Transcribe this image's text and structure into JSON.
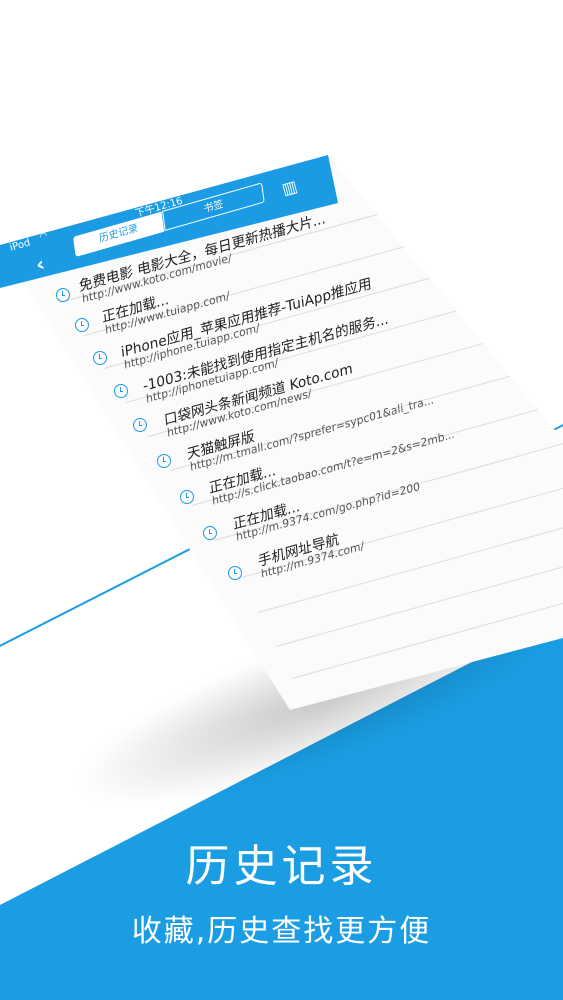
{
  "status_bar": {
    "carrier": "iPod",
    "time": "下午12:16"
  },
  "nav": {
    "tabs": [
      {
        "label": "历史记录",
        "active": true
      },
      {
        "label": "书签",
        "active": false
      }
    ],
    "back_icon": "chevron-left-icon",
    "trash_icon": "trash-icon"
  },
  "history": [
    {
      "title": "免费电影 电影大全，每日更新热播大片...",
      "url": "http://www.koto.com/movie/"
    },
    {
      "title": "正在加载...",
      "url": "http://www.tuiapp.com/"
    },
    {
      "title": "iPhone应用_苹果应用推荐-TuiApp推应用",
      "url": "http://iphone.tuiapp.com/"
    },
    {
      "title": "-1003:未能找到使用指定主机名的服务...",
      "url": "http://iphonetuiapp.com/"
    },
    {
      "title": "口袋网头条新闻频道 Koto.com",
      "url": "http://www.koto.com/news/"
    },
    {
      "title": "天猫触屏版",
      "url": "http://m.tmall.com/?sprefer=sypc01&ali_tra..."
    },
    {
      "title": "正在加载...",
      "url": "http://s.click.taobao.com/t?e=m=2&s=2mb..."
    },
    {
      "title": "正在加载...",
      "url": "http://m.9374.com/go.php?id=200"
    },
    {
      "title": "手机网址导航",
      "url": "http://m.9374.com/"
    }
  ],
  "caption": {
    "title": "历史记录",
    "subtitle": "收藏,历史查找更方便"
  },
  "colors": {
    "accent": "#1b9be4",
    "background": "#ffffff"
  }
}
